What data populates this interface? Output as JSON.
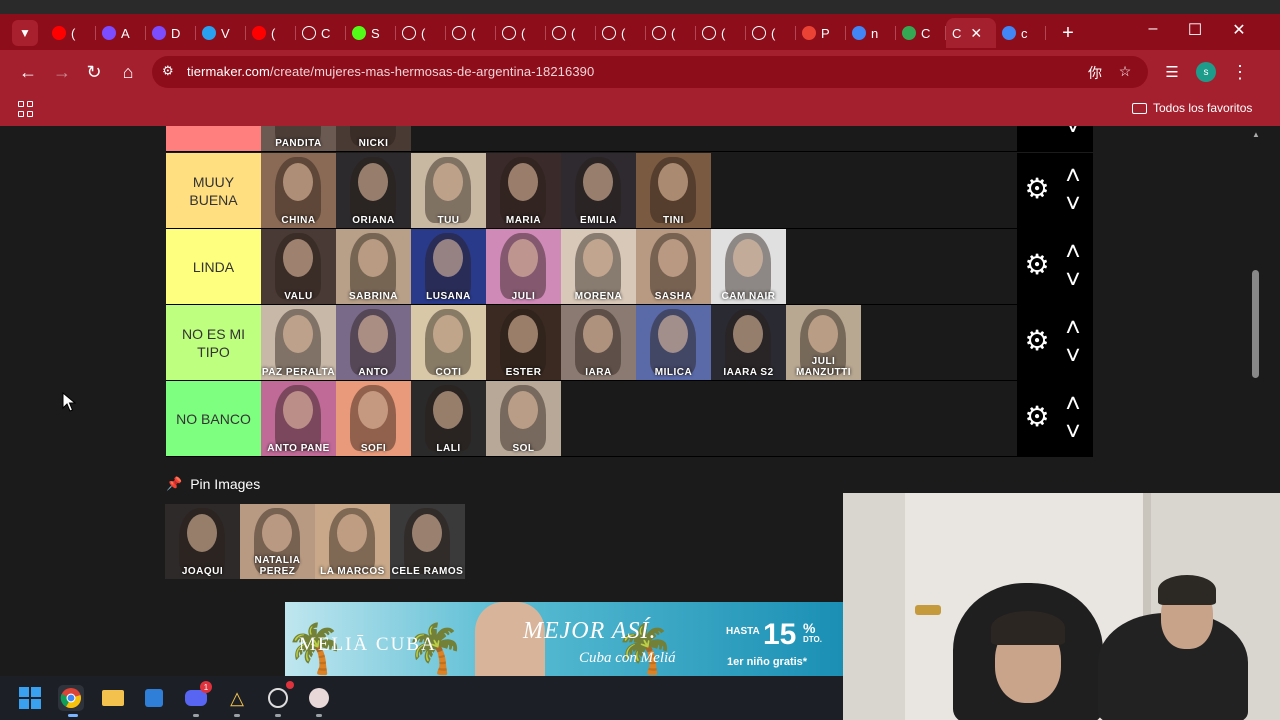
{
  "browser": {
    "url_host": "tiermaker.com",
    "url_path": "/create/mujeres-mas-hermosas-de-argentina-18216390",
    "bookmarks_folder": "Todos los favoritos",
    "profile_initial": "s",
    "tabs": [
      {
        "label": "(",
        "icon": "youtube-icon",
        "color": "#ff0000"
      },
      {
        "label": "A",
        "icon": "half-moon-icon",
        "color": "#7b4dff"
      },
      {
        "label": "D",
        "icon": "half-moon-icon",
        "color": "#7b4dff"
      },
      {
        "label": "V",
        "icon": "check-badge-icon",
        "color": "#2aa0f0"
      },
      {
        "label": "(",
        "icon": "youtube-icon",
        "color": "#ff0000"
      },
      {
        "label": "C",
        "icon": "openai-icon",
        "color": "#ffffff"
      },
      {
        "label": "S",
        "icon": "kick-icon",
        "color": "#53fc18"
      },
      {
        "label": "(",
        "icon": "tiktok-icon",
        "color": "#ffffff"
      },
      {
        "label": "(",
        "icon": "tiktok-icon",
        "color": "#ffffff"
      },
      {
        "label": "(",
        "icon": "tiktok-icon",
        "color": "#ffffff"
      },
      {
        "label": "(",
        "icon": "tiktok-icon",
        "color": "#ffffff"
      },
      {
        "label": "(",
        "icon": "tiktok-icon",
        "color": "#ffffff"
      },
      {
        "label": "(",
        "icon": "tiktok-icon",
        "color": "#ffffff"
      },
      {
        "label": "(",
        "icon": "tiktok-icon",
        "color": "#ffffff"
      },
      {
        "label": "(",
        "icon": "tiktok-icon",
        "color": "#ffffff"
      },
      {
        "label": "P",
        "icon": "gmail-icon",
        "color": "#ea4335"
      },
      {
        "label": "n",
        "icon": "google-icon",
        "color": "#4285f4"
      },
      {
        "label": "C",
        "icon": "sheets-icon",
        "color": "#34a853"
      },
      {
        "label": "C",
        "icon": "close-icon",
        "color": "#ffffff",
        "active": true
      },
      {
        "label": "c",
        "icon": "google-icon",
        "color": "#4285f4"
      }
    ]
  },
  "tiers": [
    {
      "label": "",
      "color": "#ff7f7f",
      "items": [
        {
          "name": "PANDITA",
          "bg": "#6b5a52"
        },
        {
          "name": "NICKI",
          "bg": "#4a3a34"
        }
      ]
    },
    {
      "label": "MUUY BUENA",
      "color": "#ffdf7f",
      "items": [
        {
          "name": "CHINA",
          "bg": "#8a6a55"
        },
        {
          "name": "ORIANA",
          "bg": "#2c2a2c"
        },
        {
          "name": "TUU",
          "bg": "#c8b8a2"
        },
        {
          "name": "MARIA",
          "bg": "#3a2a2a"
        },
        {
          "name": "EMILIA",
          "bg": "#2e2a30"
        },
        {
          "name": "TINI",
          "bg": "#7a5a40"
        }
      ]
    },
    {
      "label": "LINDA",
      "color": "#ffff7f",
      "items": [
        {
          "name": "VALU",
          "bg": "#4a3a35"
        },
        {
          "name": "SABRINA",
          "bg": "#b8a088"
        },
        {
          "name": "LUSANA",
          "bg": "#2a3a8a"
        },
        {
          "name": "JULI",
          "bg": "#d08ab8"
        },
        {
          "name": "MORENA",
          "bg": "#d8c8b8"
        },
        {
          "name": "SASHA",
          "bg": "#b89a82"
        },
        {
          "name": "CAM NAIR",
          "bg": "#e0e0e0"
        }
      ]
    },
    {
      "label": "NO ES MI TIPO",
      "color": "#bfff7f",
      "items": [
        {
          "name": "PAZ PERALTA",
          "bg": "#c8b8a8"
        },
        {
          "name": "ANTO",
          "bg": "#7a6a8a"
        },
        {
          "name": "COTI",
          "bg": "#d8c8a8"
        },
        {
          "name": "ESTER",
          "bg": "#3a2a22"
        },
        {
          "name": "IARA",
          "bg": "#8a7a72"
        },
        {
          "name": "MILICA",
          "bg": "#5a6aa8"
        },
        {
          "name": "IAARA S2",
          "bg": "#2a2a32"
        },
        {
          "name": "JULI MANZUTTI",
          "bg": "#b8a892"
        }
      ]
    },
    {
      "label": "NO BANCO",
      "color": "#7fff7f",
      "items": [
        {
          "name": "ANTO PANE",
          "bg": "#c06a98"
        },
        {
          "name": "SOFI",
          "bg": "#e89a7a"
        },
        {
          "name": "LALI",
          "bg": "#2a2a2a"
        },
        {
          "name": "SOL",
          "bg": "#b8a898"
        }
      ]
    }
  ],
  "pin": {
    "title": "Pin Images",
    "items": [
      {
        "name": "JOAQUI",
        "bg": "#2e2a2a"
      },
      {
        "name": "NATALIA PEREZ",
        "bg": "#b89a82"
      },
      {
        "name": "LA MARCOS",
        "bg": "#c8a888"
      },
      {
        "name": "CELE RAMOS",
        "bg": "#3a3a3a"
      }
    ]
  },
  "ad": {
    "brand": "MELIĀ CUBA",
    "headline": "MEJOR ASÍ.",
    "subline": "Cuba con Meliá",
    "hasta": "HASTA",
    "discount": "15",
    "discount_sign": "%",
    "dto": "DTO.",
    "kids": "1er niño gratis*"
  },
  "taskbar": {
    "discord_badge": "1"
  }
}
